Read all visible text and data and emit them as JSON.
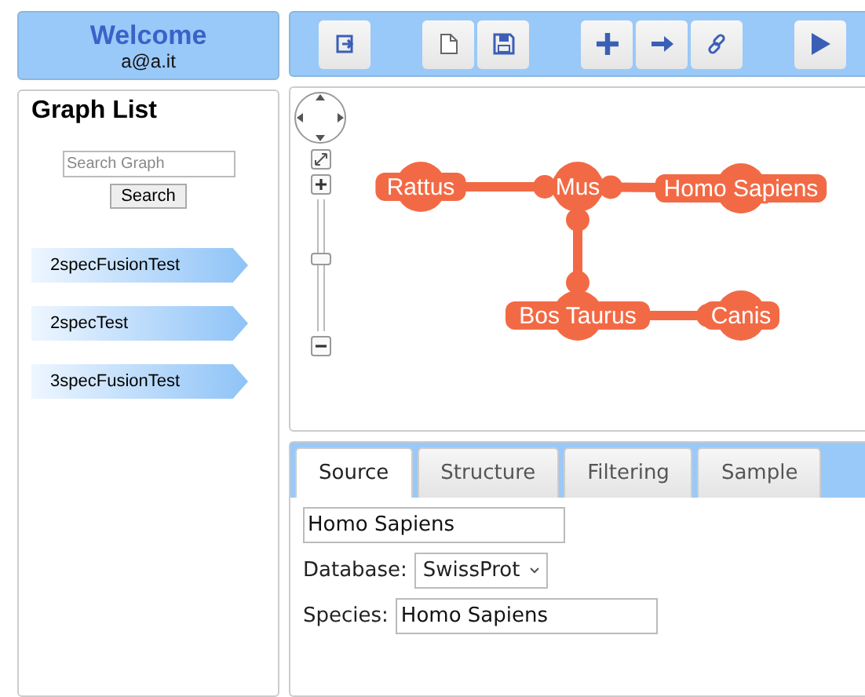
{
  "user_panel": {
    "title": "Welcome",
    "email": "a@a.it"
  },
  "toolbar": {
    "groups": [
      {
        "buttons": [
          {
            "kind": "exit"
          }
        ]
      },
      {
        "buttons": [
          {
            "kind": "new"
          },
          {
            "kind": "save"
          }
        ]
      },
      {
        "buttons": [
          {
            "kind": "add"
          },
          {
            "kind": "arrow"
          },
          {
            "kind": "link"
          }
        ]
      },
      {
        "buttons": [
          {
            "kind": "play"
          }
        ]
      }
    ]
  },
  "sidebar": {
    "title": "Graph List",
    "search": {
      "placeholder": "Search Graph",
      "button": "Search"
    },
    "items": [
      {
        "label": "2specFusionTest"
      },
      {
        "label": "2specTest"
      },
      {
        "label": "3specFusionTest"
      }
    ]
  },
  "graph": {
    "zoom": {
      "level": 0.55
    },
    "nodes": [
      {
        "label": "Rattus"
      },
      {
        "label": "Mus"
      },
      {
        "label": "Homo Sapiens"
      },
      {
        "label": "Bos Taurus"
      },
      {
        "label": "Canis"
      }
    ]
  },
  "details": {
    "tabs": [
      {
        "label": "Source",
        "selected": true
      },
      {
        "label": "Structure",
        "selected": false
      },
      {
        "label": "Filtering",
        "selected": false
      },
      {
        "label": "Sample",
        "selected": false
      }
    ],
    "name_value": "Homo Sapiens",
    "database": {
      "label": "Database:",
      "value": "SwissProt"
    },
    "species": {
      "label": "Species:",
      "value": "Homo Sapiens"
    }
  }
}
